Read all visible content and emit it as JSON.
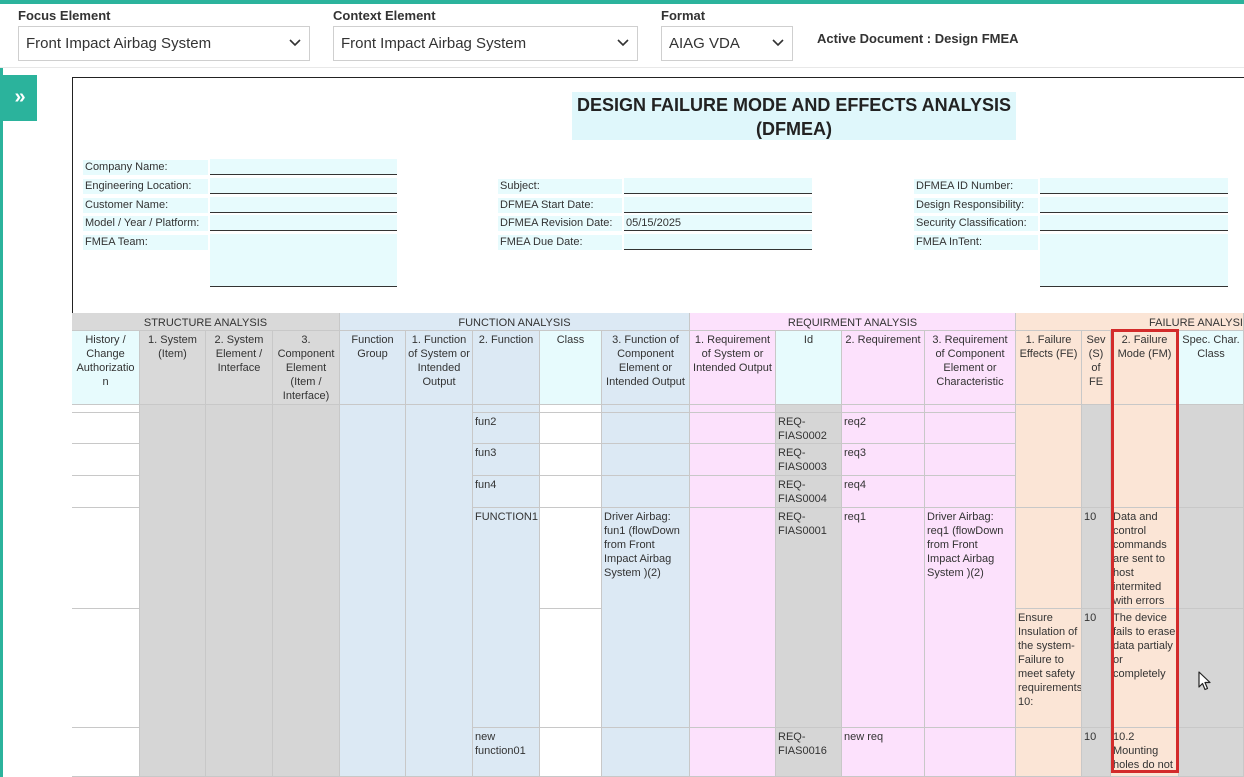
{
  "toolbar": {
    "focus_label": "Focus Element",
    "focus_value": "Front Impact Airbag System",
    "context_label": "Context Element",
    "context_value": "Front Impact Airbag System",
    "format_label": "Format",
    "format_value": "AIAG VDA",
    "active_document": "Active Document : Design FMEA"
  },
  "expand_glyph": "»",
  "document": {
    "title_line1": "DESIGN FAILURE MODE AND EFFECTS ANALYSIS",
    "title_line2": "(DFMEA)",
    "left_fields": [
      {
        "label": "Company Name:",
        "value": ""
      },
      {
        "label": "Engineering Location:",
        "value": ""
      },
      {
        "label": "Customer Name:",
        "value": ""
      },
      {
        "label": "Model / Year / Platform:",
        "value": ""
      },
      {
        "label": "FMEA Team:",
        "value": ""
      }
    ],
    "middle_fields": [
      {
        "label": "Subject:",
        "value": ""
      },
      {
        "label": "DFMEA Start Date:",
        "value": ""
      },
      {
        "label": "DFMEA Revision Date:",
        "value": "05/15/2025"
      },
      {
        "label": "FMEA Due Date:",
        "value": ""
      }
    ],
    "right_fields": [
      {
        "label": "DFMEA ID Number:",
        "value": ""
      },
      {
        "label": "Design Responsibility:",
        "value": ""
      },
      {
        "label": "Security Classification:",
        "value": ""
      },
      {
        "label": "FMEA InTent:",
        "value": ""
      }
    ]
  },
  "table": {
    "groups": {
      "structure": "STRUCTURE ANALYSIS",
      "function": "FUNCTION ANALYSIS",
      "requirement": "REQUIRMENT ANALYSIS",
      "failure": "FAILURE ANALYSI"
    },
    "headers": {
      "history": "History / Change Authorizatio n",
      "system": "1. System (Item)",
      "system_element": "2. System Element / Interface",
      "component": "3. Component Element (Item / Interface)",
      "function_group": "Function Group",
      "function_system": "1. Function of System or Intended Output",
      "function": "2. Function",
      "class": "Class",
      "function_component": "3. Function of Component Element or Intended Output",
      "req_system": "1. Requirement of System or Intended Output",
      "id": "Id",
      "requirement": "2. Requirement",
      "req_component": "3. Requirement of Component Element or Characteristic",
      "failure_effects": "1. Failure Effects (FE)",
      "severity": "Sev (S) of FE",
      "failure_mode": "2. Failure Mode (FM)",
      "spec_char": "Spec. Char. Class"
    },
    "rows": [
      {
        "function": "fun2",
        "id": "REQ-FIAS0002",
        "requirement": "req2"
      },
      {
        "function": "fun3",
        "id": "REQ-FIAS0003",
        "requirement": "req3"
      },
      {
        "function": "fun4",
        "id": "REQ-FIAS0004",
        "requirement": "req4"
      },
      {
        "function": "FUNCTION1",
        "function_component": "Driver Airbag: fun1 (flowDown from Front Impact Airbag System )(2)",
        "id": "REQ-FIAS0001",
        "requirement": "req1",
        "req_component": "Driver Airbag: req1 (flowDown from Front Impact Airbag System )(2)",
        "severity": "10",
        "failure_mode": "Data and control commands are sent to host intermited with errors"
      },
      {
        "failure_effects": "Ensure Insulation of the system- Failure to meet safety requirements: 10:",
        "severity": "10",
        "failure_mode": "The device fails to erase data partialy or completely"
      },
      {
        "function": "new function01",
        "id": "REQ-FIAS0016",
        "requirement": "new req",
        "severity": "10",
        "failure_mode": "10.2 Mounting holes do not"
      }
    ]
  }
}
